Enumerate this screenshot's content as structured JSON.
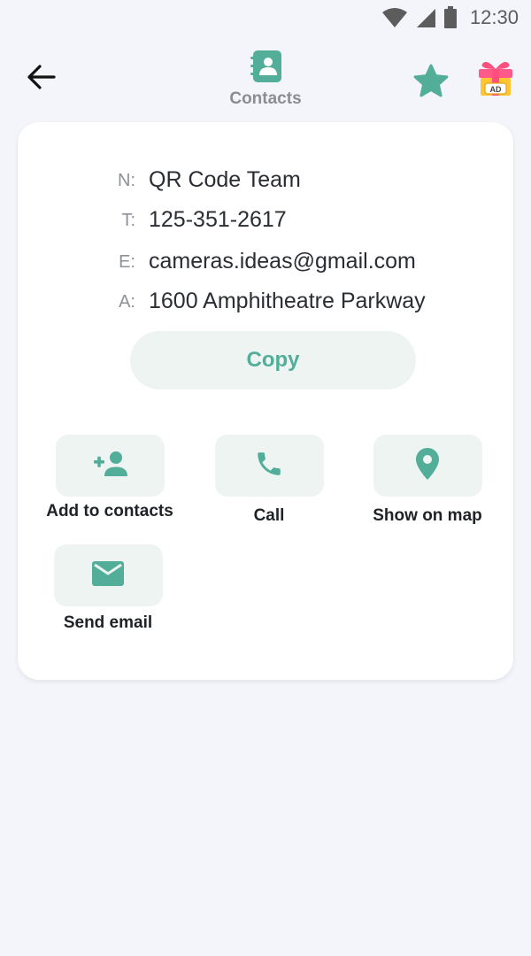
{
  "status_bar": {
    "time": "12:30"
  },
  "header": {
    "title": "Contacts",
    "back_icon": "arrow-left-icon",
    "favorite_icon": "star-icon",
    "ad_icon": "gift-ad-icon",
    "ad_badge": "AD"
  },
  "contact": {
    "fields": [
      {
        "label": "N:",
        "value": "QR Code Team"
      },
      {
        "label": "T:",
        "value": "125-351-2617"
      },
      {
        "label": "E:",
        "value": "cameras.ideas@gmail.com"
      },
      {
        "label": "A:",
        "value": "1600 Amphitheatre Parkway"
      }
    ],
    "copy_label": "Copy"
  },
  "actions": [
    {
      "label": "Add to contacts",
      "icon": "add-person-icon"
    },
    {
      "label": "Call",
      "icon": "phone-icon"
    },
    {
      "label": "Show on map",
      "icon": "map-pin-icon"
    },
    {
      "label": "Send email",
      "icon": "email-icon"
    }
  ],
  "colors": {
    "accent": "#52ae99",
    "tile_bg": "#eef4f2",
    "background": "#f4f5fa",
    "card": "#ffffff"
  }
}
